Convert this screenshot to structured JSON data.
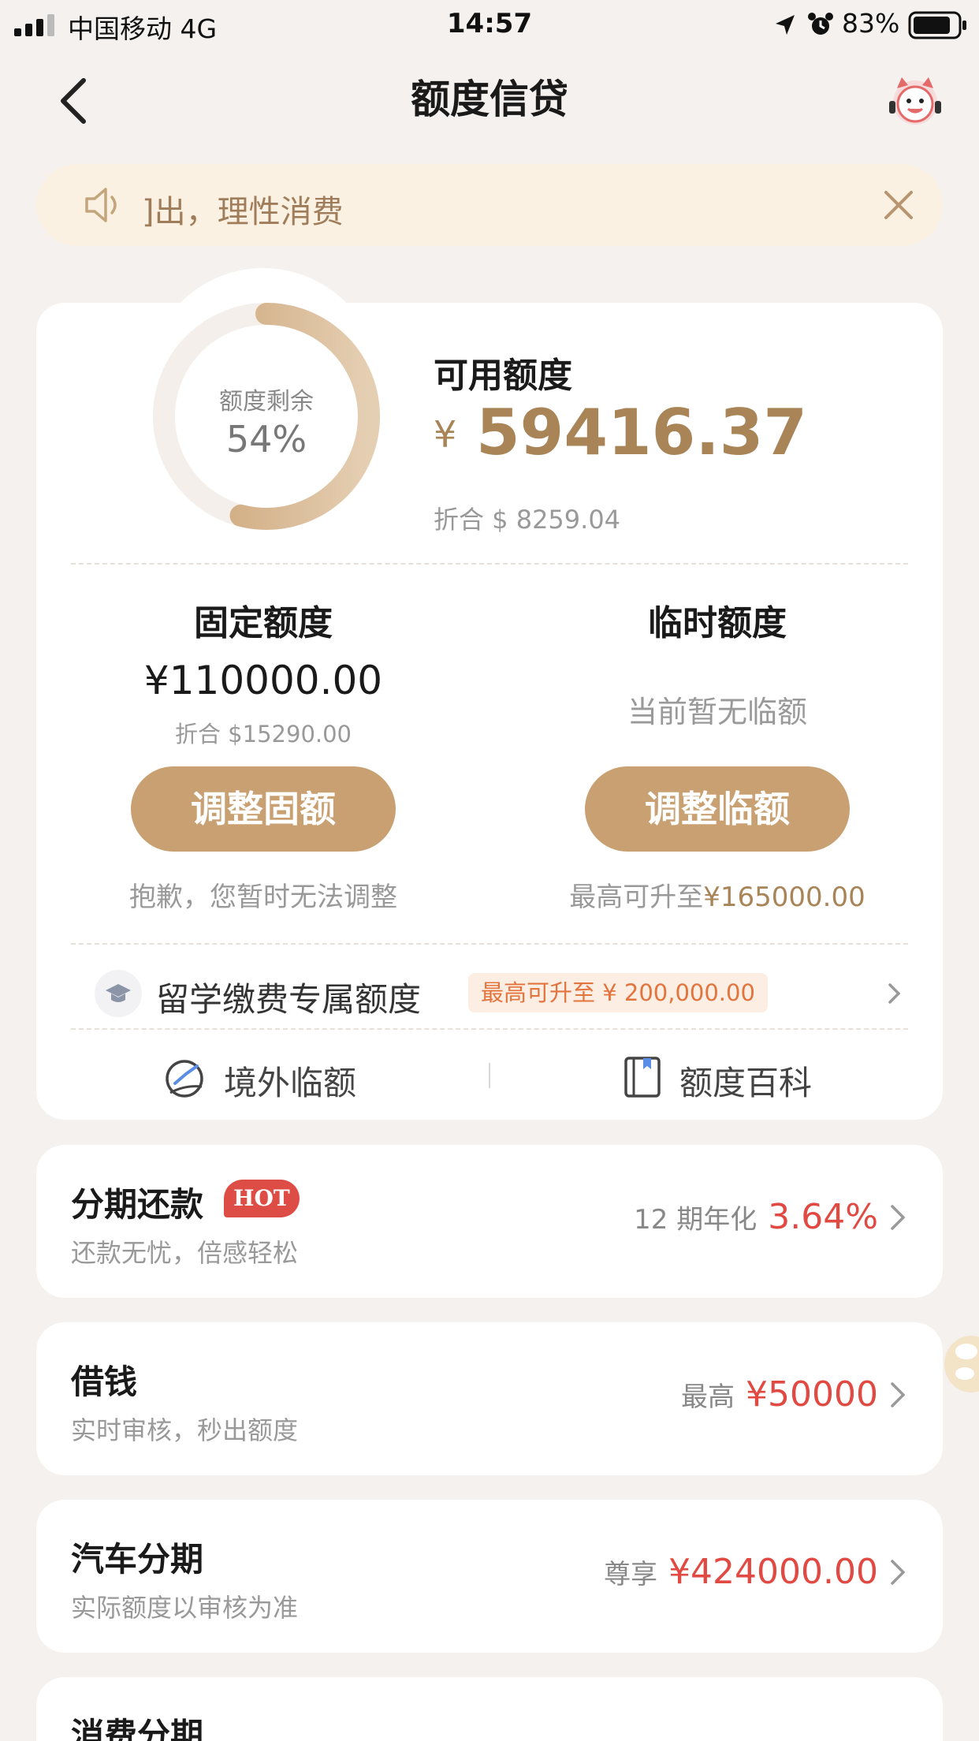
{
  "status_bar": {
    "carrier": "中国移动  4G",
    "time": "14:57",
    "battery": "83%"
  },
  "nav": {
    "title": "额度信贷"
  },
  "notice": {
    "text": "]出，理性消费"
  },
  "quota": {
    "ring_label": "额度剩余",
    "ring_percent": "54%",
    "ring_fraction": 0.54,
    "available_label": "可用额度",
    "currency_symbol": "¥",
    "available_amount": "59416.37",
    "available_usd": "折合 $ 8259.04"
  },
  "fixed": {
    "label": "固定额度",
    "amount": "¥110000.00",
    "usd": "折合 $15290.00",
    "button": "调整固额",
    "note": "抱歉，您暂时无法调整"
  },
  "temp": {
    "label": "临时额度",
    "status": "当前暂无临额",
    "button": "调整临额",
    "note_prefix": "最高可升至",
    "note_amount": "¥165000.00"
  },
  "study": {
    "label": "留学缴费专属额度",
    "badge": "最高可升至 ¥ 200,000.00"
  },
  "links": {
    "overseas": "境外临额",
    "wiki": "额度百科"
  },
  "products": [
    {
      "title": "分期还款",
      "badge": "HOT",
      "subtitle": "还款无忧，倍感轻松",
      "prefix": "12 期年化",
      "value": "3.64%"
    },
    {
      "title": "借钱",
      "subtitle": "实时审核，秒出额度",
      "prefix": "最高",
      "value": "¥50000"
    },
    {
      "title": "汽车分期",
      "subtitle": "实际额度以审核为准",
      "prefix": "尊享",
      "value": "¥424000.00"
    },
    {
      "title": "消费分期"
    }
  ],
  "colors": {
    "accent": "#c9a071",
    "accent_text": "#a88457",
    "highlight": "#e04a43",
    "notice_bg": "#fbf1e2"
  }
}
